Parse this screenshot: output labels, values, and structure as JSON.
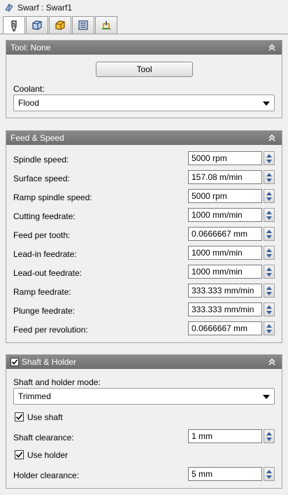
{
  "window": {
    "title": "Swarf : Swarf1",
    "icon": "swarf-icon"
  },
  "tabs": [
    {
      "icon": "tool-icon",
      "active": true
    },
    {
      "icon": "geometry-icon",
      "active": false
    },
    {
      "icon": "heights-icon",
      "active": false
    },
    {
      "icon": "passes-icon",
      "active": false
    },
    {
      "icon": "linking-icon",
      "active": false
    }
  ],
  "tool_panel": {
    "title": "Tool: None",
    "tool_button": "Tool",
    "coolant_label": "Coolant:",
    "coolant_value": "Flood"
  },
  "feed_panel": {
    "title": "Feed & Speed",
    "rows": [
      {
        "label": "Spindle speed:",
        "value": "5000 rpm"
      },
      {
        "label": "Surface speed:",
        "value": "157.08 m/min"
      },
      {
        "label": "Ramp spindle speed:",
        "value": "5000 rpm"
      },
      {
        "label": "Cutting feedrate:",
        "value": "1000 mm/min"
      },
      {
        "label": "Feed per tooth:",
        "value": "0.0666667 mm"
      },
      {
        "label": "Lead-in feedrate:",
        "value": "1000 mm/min"
      },
      {
        "label": "Lead-out feedrate:",
        "value": "1000 mm/min"
      },
      {
        "label": "Ramp feedrate:",
        "value": "333.333 mm/min"
      },
      {
        "label": "Plunge feedrate:",
        "value": "333.333 mm/min"
      },
      {
        "label": "Feed per revolution:",
        "value": "0.0666667 mm"
      }
    ]
  },
  "shaft_panel": {
    "title": "Shaft & Holder",
    "enabled": true,
    "mode_label": "Shaft and holder mode:",
    "mode_value": "Trimmed",
    "use_shaft_label": "Use shaft",
    "use_shaft_checked": true,
    "shaft_clearance_label": "Shaft clearance:",
    "shaft_clearance_value": "1 mm",
    "use_holder_label": "Use holder",
    "use_holder_checked": true,
    "holder_clearance_label": "Holder clearance:",
    "holder_clearance_value": "5 mm"
  }
}
